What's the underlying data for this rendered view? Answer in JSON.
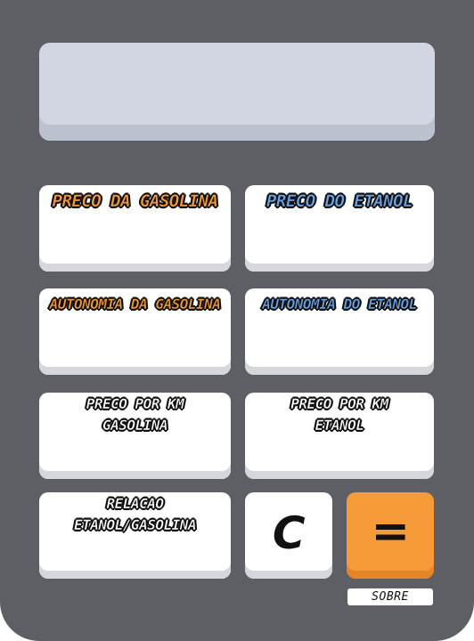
{
  "display": {
    "value": ""
  },
  "keys": {
    "preco_gasolina": "PRECO DA GASOLINA",
    "preco_etanol": "PRECO DO ETANOL",
    "autonomia_gasolina": "AUTONOMIA DA GASOLINA",
    "autonomia_etanol": "AUTONOMIA DO ETANOL",
    "preco_km_gasolina": [
      "PRECO POR KM",
      "GASOLINA"
    ],
    "preco_km_etanol": [
      "PRECO POR KM",
      "ETANOL"
    ],
    "relacao": [
      "RELACAO",
      "ETANOL/GASOLINA"
    ],
    "clear": "C",
    "equals": "="
  },
  "footer": {
    "sobre": "SOBRE"
  },
  "colors": {
    "body": "#5e5f64",
    "display": "#d1d6e2",
    "gasolina_accent": "#f39a36",
    "etanol_accent": "#6aa1e2",
    "equals_button": "#f79a3a"
  }
}
